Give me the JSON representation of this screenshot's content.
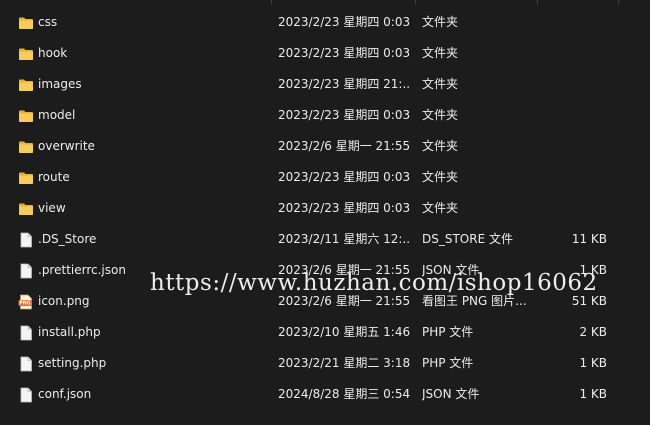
{
  "files": [
    {
      "name": "css",
      "date": "2023/2/23 星期四 0:03",
      "type": "文件夹",
      "size": "",
      "icon": "folder-icon"
    },
    {
      "name": "hook",
      "date": "2023/2/23 星期四 0:03",
      "type": "文件夹",
      "size": "",
      "icon": "folder-icon"
    },
    {
      "name": "images",
      "date": "2023/2/23 星期四 21:...",
      "type": "文件夹",
      "size": "",
      "icon": "folder-icon"
    },
    {
      "name": "model",
      "date": "2023/2/23 星期四 0:03",
      "type": "文件夹",
      "size": "",
      "icon": "folder-icon"
    },
    {
      "name": "overwrite",
      "date": "2023/2/6 星期一 21:55",
      "type": "文件夹",
      "size": "",
      "icon": "folder-icon"
    },
    {
      "name": "route",
      "date": "2023/2/23 星期四 0:03",
      "type": "文件夹",
      "size": "",
      "icon": "folder-icon"
    },
    {
      "name": "view",
      "date": "2023/2/23 星期四 0:03",
      "type": "文件夹",
      "size": "",
      "icon": "folder-icon"
    },
    {
      "name": ".DS_Store",
      "date": "2023/2/11 星期六 12:...",
      "type": "DS_STORE 文件",
      "size": "11 KB",
      "icon": "file-icon"
    },
    {
      "name": ".prettierrc.json",
      "date": "2023/2/6 星期一 21:55",
      "type": "JSON 文件",
      "size": "1 KB",
      "icon": "file-icon"
    },
    {
      "name": "icon.png",
      "date": "2023/2/6 星期一 21:55",
      "type": "看图王 PNG 图片...",
      "size": "51 KB",
      "icon": "png-image-icon"
    },
    {
      "name": "install.php",
      "date": "2023/2/10 星期五 1:46",
      "type": "PHP 文件",
      "size": "2 KB",
      "icon": "file-icon"
    },
    {
      "name": "setting.php",
      "date": "2023/2/21 星期二 3:18",
      "type": "PHP 文件",
      "size": "1 KB",
      "icon": "file-icon"
    },
    {
      "name": "conf.json",
      "date": "2024/8/28 星期三 0:54",
      "type": "JSON 文件",
      "size": "1 KB",
      "icon": "file-icon"
    }
  ],
  "watermark": "https://www.huzhan.com/ishop16062",
  "colors": {
    "background": "#1c1c1c",
    "folder": "#f0c050",
    "text": "#ececec"
  }
}
